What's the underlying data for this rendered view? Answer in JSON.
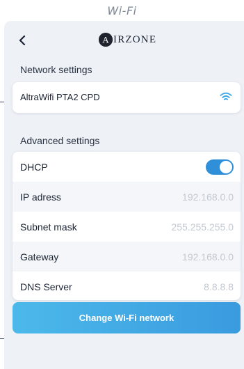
{
  "caption": "Wi-Fi",
  "header": {
    "brand_letter": "A",
    "brand_rest": "IRZONE",
    "back_icon": "chevron-left-icon"
  },
  "network": {
    "section_title": "Network settings",
    "ssid": "AltraWifi PTA2 CPD",
    "wifi_icon": "wifi-icon",
    "accent": "#35a3e6"
  },
  "advanced": {
    "section_title": "Advanced settings",
    "dhcp_label": "DHCP",
    "dhcp_on": true,
    "toggle_color": "#2f8fd8",
    "rows": [
      {
        "label": "IP adress",
        "value": "192.168.0.0"
      },
      {
        "label": "Subnet mask",
        "value": "255.255.255.0"
      },
      {
        "label": "Gateway",
        "value": "192.168.0.0"
      },
      {
        "label": "DNS Server",
        "value": "8.8.8.8"
      }
    ]
  },
  "actions": {
    "change_network_label": "Change Wi-Fi network"
  }
}
